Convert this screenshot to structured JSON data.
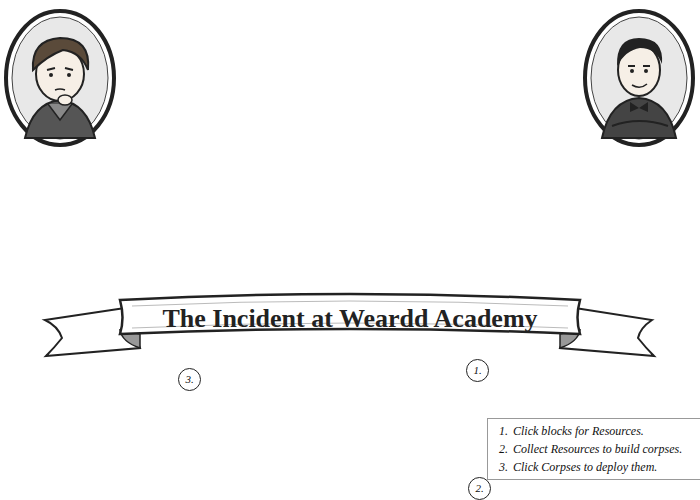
{
  "title": "The Incident at Weardd Academy",
  "markers": [
    {
      "label": "3."
    },
    {
      "label": "1."
    },
    {
      "label": "2."
    }
  ],
  "instructions": [
    {
      "number": "1.",
      "text": "Click blocks for Resources."
    },
    {
      "number": "2.",
      "text": "Collect Resources to build corpses."
    },
    {
      "number": "3.",
      "text": "Click Corpses to deploy them."
    }
  ]
}
